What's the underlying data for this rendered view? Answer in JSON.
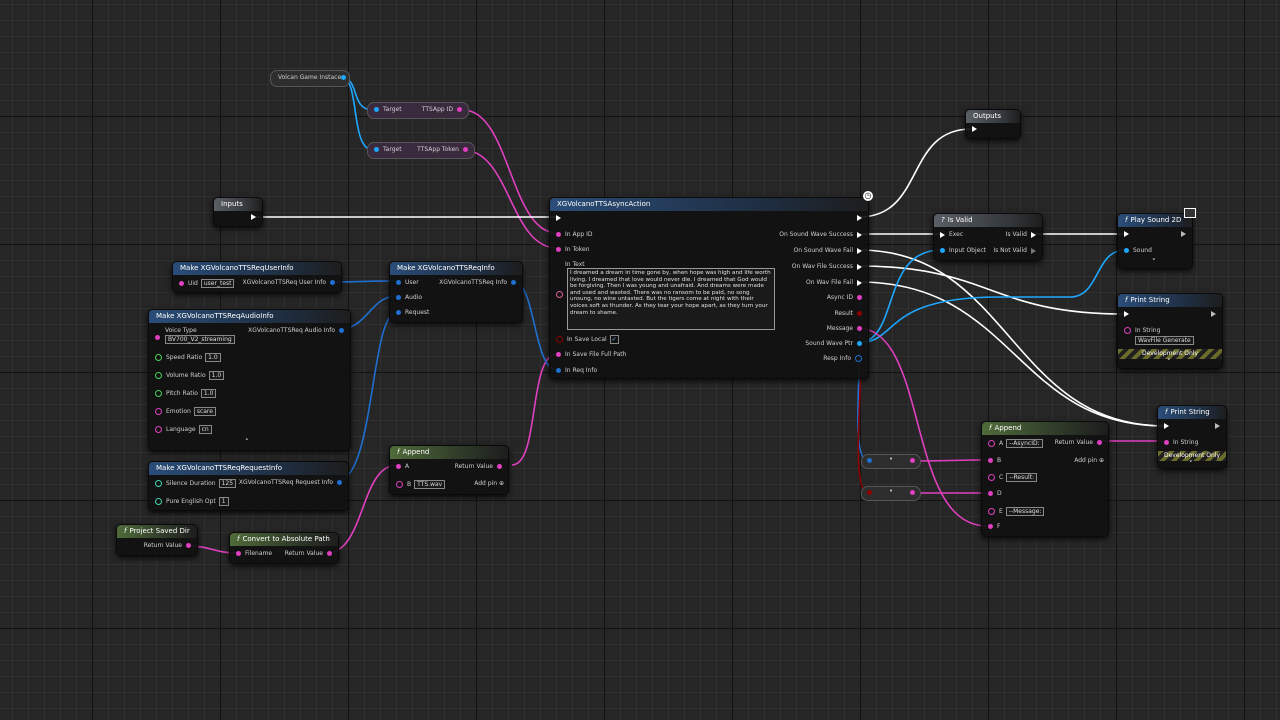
{
  "colors": {
    "exec": "#ffffff",
    "string": "#e040c0",
    "object": "#1ea7ff",
    "struct": "#1f6fd0",
    "float": "#42d45a",
    "integer": "#3cd6b0",
    "byte": "#0c7a60",
    "bool": "#8b0000",
    "text": "#e65fa0"
  },
  "wires_exec_color": "#ffffff",
  "nodes": {
    "volcan_instance": {
      "label": "Volcan Game Instace"
    },
    "get_app_id": {
      "target": "Target",
      "output": "TTSApp ID"
    },
    "get_app_token": {
      "target": "Target",
      "output": "TTSApp Token"
    },
    "inputs": {
      "title": "Inputs"
    },
    "outputs": {
      "title": "Outputs"
    },
    "make_user_info": {
      "title": "Make XGVolcanoTTSReqUserInfo",
      "uid_label": "Uid",
      "uid_value": "user_test",
      "output": "XGVolcanoTTSReq User Info"
    },
    "make_audio_info": {
      "title": "Make XGVolcanoTTSReqAudioInfo",
      "voice_type_label": "Voice Type",
      "voice_type_value": "BV700_V2_streaming",
      "speed_label": "Speed Ratio",
      "speed_value": "1.0",
      "volume_label": "Volume Ratio",
      "volume_value": "1.0",
      "pitch_label": "Pitch Ratio",
      "pitch_value": "1.0",
      "emotion_label": "Emotion",
      "emotion_value": "scare",
      "language_label": "Language",
      "language_value": "cn",
      "output": "XGVolcanoTTSReq Audio Info"
    },
    "make_request_info": {
      "title": "Make XGVolcanoTTSReqRequestInfo",
      "silence_label": "Silence Duration",
      "silence_value": "125",
      "pure_label": "Pure English Opt",
      "pure_value": "1",
      "output": "XGVolcanoTTSReq Request Info"
    },
    "make_req_info": {
      "title": "Make XGVolcanoTTSReqInfo",
      "user": "User",
      "audio": "Audio",
      "request": "Request",
      "output": "XGVolcanoTTSReq Info"
    },
    "append_small": {
      "title": "Append",
      "a": "A",
      "b": "B",
      "b_value": "TTS.wav",
      "output": "Return Value",
      "add_pin": "Add pin"
    },
    "project_saved_dir": {
      "title": "Project Saved Dir",
      "output": "Return Value"
    },
    "convert_abs": {
      "title": "Convert to Absolute Path",
      "input": "Filename",
      "output": "Return Value"
    },
    "async_action": {
      "title": "XGVolcanoTTSAsyncAction",
      "in_app_id": "In App ID",
      "in_token": "In Token",
      "in_text": "In Text",
      "text_value": "I dreamed a dream in time gone by, when hope was high and life worth living. I dreamed that love would never die. I dreamed that God would be forgiving. Then I was young and unafraid. And dreams were made and used and wasted. There was no ransom to be paid, no song unsung, no wine untasted. But the tigers come at night with their voices soft as thunder. As they tear your hope apart, as they turn your dream to shame.",
      "in_save_local": "In Save Local",
      "in_save_path": "In Save File Full Path",
      "in_req_info": "In Req Info",
      "out_success": "On Sound Wave Success",
      "out_fail": "On Sound Wave Fail",
      "out_wav_success": "On Wav File Success",
      "out_wav_fail": "On Wav File Fail",
      "out_async_id": "Async ID",
      "out_result": "Result",
      "out_message": "Message",
      "out_sound_wave_ptr": "Sound Wave Ptr",
      "out_resp_info": "Resp Info"
    },
    "is_valid": {
      "title": "Is Valid",
      "exec": "Exec",
      "input_object": "Input Object",
      "is_valid": "Is Valid",
      "is_not_valid": "Is Not Valid"
    },
    "play_sound": {
      "title": "Play Sound 2D",
      "sound": "Sound"
    },
    "print_string_1": {
      "title": "Print String",
      "in_string": "In String",
      "value": "WavFile Generate",
      "dev_only": "Development Only"
    },
    "print_string_2": {
      "title": "Print String",
      "in_string": "In String",
      "dev_only": "Development Only"
    },
    "append_big": {
      "title": "Append",
      "a": "A",
      "a_value": "--AsyncID:",
      "b": "B",
      "c": "C",
      "c_value": "--Result:",
      "d": "D",
      "e": "E",
      "e_value": "--Message:",
      "f": "F",
      "output": "Return Value",
      "add_pin": "Add pin"
    }
  }
}
